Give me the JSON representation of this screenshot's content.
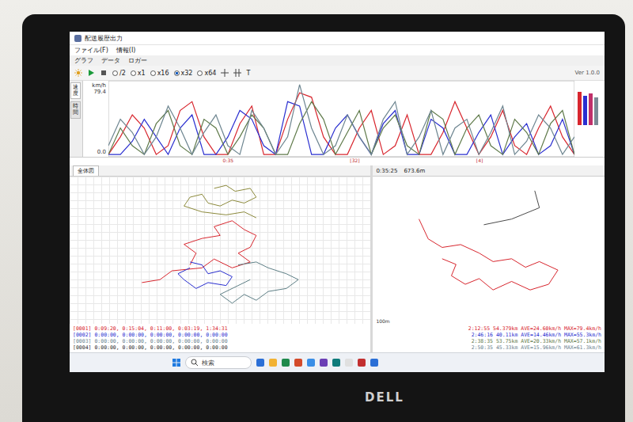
{
  "window": {
    "title": "配送履歴出力"
  },
  "menu": [
    "ファイル(F)",
    "情報(I)"
  ],
  "submenu": [
    "グラフ",
    "データ",
    "ロガー"
  ],
  "toolbar": {
    "speeds": [
      {
        "label": "/2",
        "selected": false
      },
      {
        "label": "x1",
        "selected": false
      },
      {
        "label": "x16",
        "selected": false
      },
      {
        "label": "x32",
        "selected": true
      },
      {
        "label": "x64",
        "selected": false
      }
    ],
    "text_tool": "T"
  },
  "version": "Ver 1.0.0",
  "chart": {
    "unit": "km/h",
    "max": "79.4",
    "min": "0.0",
    "side_tabs": [
      "速度",
      "時間"
    ],
    "markers": [
      "0:35",
      "[32]",
      "[4]"
    ],
    "series": [
      {
        "color": "#d8262e",
        "values": [
          0,
          20,
          45,
          30,
          0,
          10,
          50,
          60,
          20,
          0,
          0,
          35,
          55,
          0,
          0,
          40,
          70,
          65,
          20,
          0,
          0,
          30,
          50,
          0,
          10,
          45,
          0,
          0,
          25,
          60,
          30,
          0,
          20,
          50,
          10,
          0,
          30,
          55,
          20,
          0
        ]
      },
      {
        "color": "#2a2fd0",
        "values": [
          0,
          0,
          15,
          40,
          20,
          0,
          30,
          45,
          0,
          0,
          20,
          50,
          40,
          10,
          0,
          60,
          55,
          0,
          0,
          30,
          45,
          20,
          0,
          35,
          50,
          0,
          0,
          40,
          30,
          0,
          0,
          25,
          45,
          0,
          20,
          35,
          0,
          10,
          40,
          0
        ]
      },
      {
        "color": "#5f7a4a",
        "values": [
          0,
          30,
          10,
          0,
          35,
          50,
          10,
          0,
          40,
          30,
          0,
          20,
          45,
          30,
          0,
          0,
          35,
          60,
          40,
          0,
          25,
          50,
          0,
          30,
          45,
          10,
          0,
          50,
          40,
          0,
          30,
          45,
          10,
          0,
          40,
          25,
          0,
          35,
          50,
          0
        ]
      },
      {
        "color": "#6d8590",
        "values": [
          10,
          40,
          25,
          0,
          20,
          55,
          30,
          0,
          25,
          45,
          10,
          0,
          50,
          30,
          0,
          20,
          79.4,
          30,
          0,
          10,
          45,
          20,
          0,
          40,
          60,
          0,
          20,
          50,
          0,
          30,
          40,
          0,
          25,
          55,
          0,
          15,
          45,
          30,
          0,
          20
        ]
      }
    ],
    "summary_bars": [
      {
        "color": "#d8262e",
        "level": 0.85
      },
      {
        "color": "#2a2fd0",
        "level": 0.75
      },
      {
        "color": "#c0306a",
        "level": 0.8
      },
      {
        "color": "#7a8a95",
        "level": 0.7
      }
    ]
  },
  "left_pane": {
    "tabs": [
      "全体図"
    ],
    "routes": [
      {
        "color": "#8c8a3c",
        "points": [
          [
            48,
            8
          ],
          [
            52,
            6
          ],
          [
            55,
            10
          ],
          [
            60,
            8
          ],
          [
            62,
            14
          ],
          [
            58,
            18
          ],
          [
            54,
            16
          ],
          [
            50,
            20
          ],
          [
            46,
            18
          ],
          [
            44,
            12
          ],
          [
            40,
            14
          ],
          [
            38,
            20
          ],
          [
            44,
            24
          ],
          [
            52,
            26
          ],
          [
            58,
            24
          ],
          [
            62,
            28
          ]
        ]
      },
      {
        "color": "#d8262e",
        "points": [
          [
            40,
            60
          ],
          [
            42,
            52
          ],
          [
            38,
            46
          ],
          [
            44,
            42
          ],
          [
            50,
            40
          ],
          [
            48,
            34
          ],
          [
            54,
            30
          ],
          [
            58,
            36
          ],
          [
            62,
            40
          ],
          [
            60,
            48
          ],
          [
            56,
            52
          ],
          [
            60,
            58
          ],
          [
            54,
            62
          ],
          [
            48,
            56
          ],
          [
            44,
            62
          ],
          [
            34,
            64
          ],
          [
            30,
            70
          ],
          [
            24,
            72
          ]
        ]
      },
      {
        "color": "#2a2fd0",
        "points": [
          [
            40,
            58
          ],
          [
            44,
            60
          ],
          [
            46,
            66
          ],
          [
            50,
            64
          ],
          [
            54,
            68
          ],
          [
            52,
            74
          ],
          [
            46,
            72
          ],
          [
            42,
            76
          ],
          [
            38,
            70
          ],
          [
            36,
            66
          ],
          [
            40,
            62
          ]
        ]
      },
      {
        "color": "#5e7f86",
        "points": [
          [
            56,
            60
          ],
          [
            62,
            58
          ],
          [
            66,
            62
          ],
          [
            72,
            66
          ],
          [
            76,
            70
          ],
          [
            72,
            76
          ],
          [
            66,
            78
          ],
          [
            62,
            84
          ],
          [
            58,
            80
          ],
          [
            54,
            86
          ],
          [
            50,
            80
          ],
          [
            56,
            74
          ],
          [
            60,
            70
          ]
        ]
      }
    ]
  },
  "right_pane": {
    "time": "0:35:25",
    "distance": "673.6m",
    "scale": "100m",
    "routes": [
      {
        "color": "#4a4a4a",
        "points": [
          [
            70,
            10
          ],
          [
            72,
            22
          ],
          [
            60,
            30
          ],
          [
            48,
            34
          ]
        ]
      },
      {
        "color": "#d8262e",
        "points": [
          [
            20,
            30
          ],
          [
            24,
            44
          ],
          [
            30,
            50
          ],
          [
            38,
            48
          ],
          [
            46,
            54
          ],
          [
            52,
            60
          ],
          [
            60,
            58
          ],
          [
            66,
            64
          ],
          [
            72,
            60
          ],
          [
            80,
            66
          ],
          [
            76,
            76
          ],
          [
            68,
            80
          ],
          [
            60,
            74
          ],
          [
            52,
            80
          ],
          [
            46,
            72
          ],
          [
            40,
            76
          ],
          [
            34,
            70
          ],
          [
            36,
            62
          ],
          [
            30,
            58
          ]
        ]
      }
    ],
    "stats": [
      {
        "text": "2:12:55 54.379km AVE=24.60km/h MAX=79.4km/h",
        "color": "#d8262e"
      },
      {
        "text": "2:46:16 40.11km AVE=14.46km/h MAX=55.3km/h",
        "color": "#2a2fd0"
      },
      {
        "text": "2:38:35 53.75km AVE=20.33km/h MAX=57.1km/h",
        "color": "#5f7a4a"
      },
      {
        "text": "2:50:35 45.33km AVE=15.96km/h MAX=61.3km/h",
        "color": "#6d8590"
      }
    ]
  },
  "log": {
    "lines": [
      {
        "text": "[0001] 0:09:20, 0:15:04, 0:11:00, 0:03:19, 1:34:31",
        "color": "#d8262e"
      },
      {
        "text": "[0002] 0:00:00, 0:00:00, 0:00:00, 0:00:00, 0:00:00",
        "color": "#2a2fd0"
      },
      {
        "text": "[0003] 0:00:00, 0:00:00, 0:00:00, 0:00:00, 0:00:00",
        "color": "#6d8590"
      },
      {
        "text": "[0004] 0:00:00, 0:00:00, 0:00:00, 0:00:00, 0:00:00",
        "color": "#333333"
      }
    ]
  },
  "taskbar": {
    "search": "検索",
    "apps": [
      {
        "color": "#2b6fd6"
      },
      {
        "color": "#f2b233"
      },
      {
        "color": "#1f8a4c"
      },
      {
        "color": "#d34a2a"
      },
      {
        "color": "#3a8ee6"
      },
      {
        "color": "#6b3fb5"
      },
      {
        "color": "#0f7b7b"
      },
      {
        "color": "#e0e0e0"
      },
      {
        "color": "#c22f2f"
      },
      {
        "color": "#2b6fd6"
      }
    ]
  },
  "monitor": {
    "brand": "DELL"
  }
}
